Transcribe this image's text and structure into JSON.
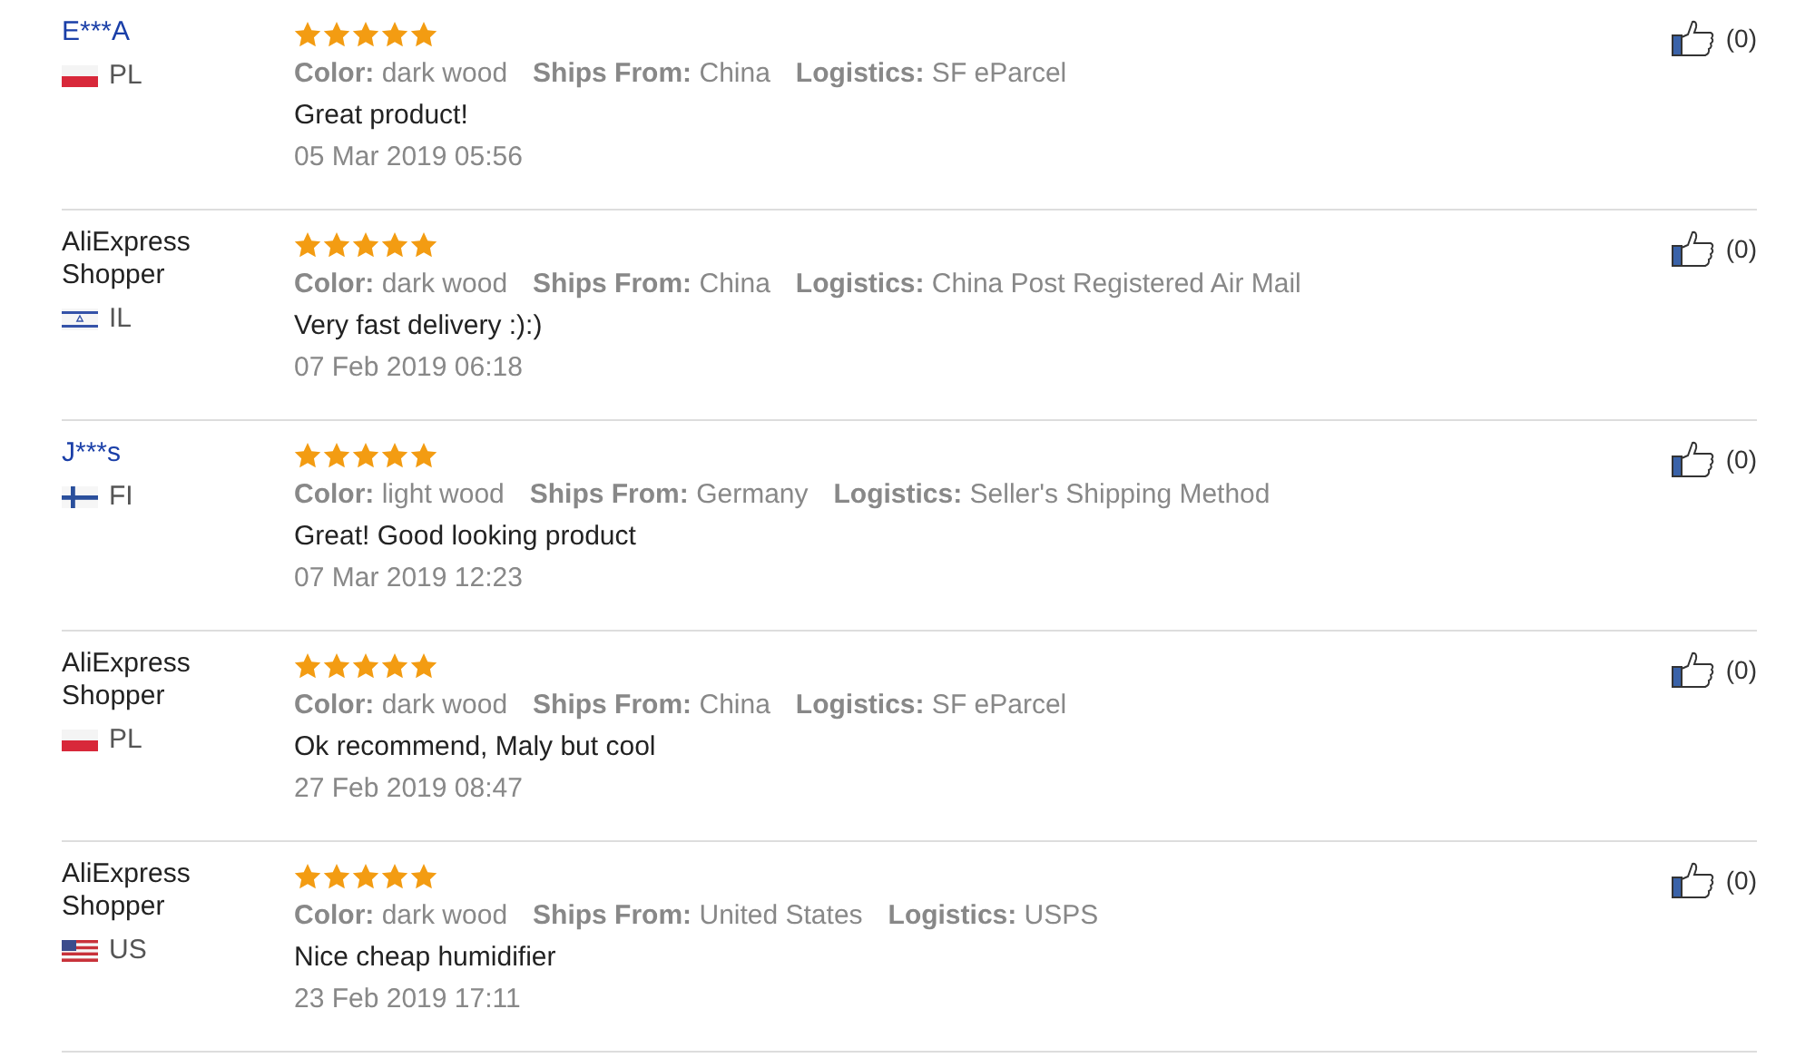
{
  "reviews": [
    {
      "name": "E***A",
      "linked": true,
      "flag": {
        "kind": "pl"
      },
      "country": "PL",
      "stars": 5,
      "attributes": [
        {
          "label": "Color:",
          "value": "dark wood"
        },
        {
          "label": "Ships From:",
          "value": "China"
        },
        {
          "label": "Logistics:",
          "value": "SF eParcel"
        }
      ],
      "text": "Great product!",
      "date": "05 Mar 2019 05:56",
      "likes": "(0)"
    },
    {
      "name": "AliExpress Shopper",
      "linked": false,
      "flag": {
        "kind": "il"
      },
      "country": "IL",
      "stars": 5,
      "attributes": [
        {
          "label": "Color:",
          "value": "dark wood"
        },
        {
          "label": "Ships From:",
          "value": "China"
        },
        {
          "label": "Logistics:",
          "value": "China Post Registered Air Mail"
        }
      ],
      "text": "Very fast delivery :):)",
      "date": "07 Feb 2019 06:18",
      "likes": "(0)"
    },
    {
      "name": "J***s",
      "linked": true,
      "flag": {
        "kind": "fi"
      },
      "country": "FI",
      "stars": 5,
      "attributes": [
        {
          "label": "Color:",
          "value": "light wood"
        },
        {
          "label": "Ships From:",
          "value": "Germany"
        },
        {
          "label": "Logistics:",
          "value": "Seller's Shipping Method"
        }
      ],
      "text": "Great! Good looking product",
      "date": "07 Mar 2019 12:23",
      "likes": "(0)"
    },
    {
      "name": "AliExpress Shopper",
      "linked": false,
      "flag": {
        "kind": "pl"
      },
      "country": "PL",
      "stars": 5,
      "attributes": [
        {
          "label": "Color:",
          "value": "dark wood"
        },
        {
          "label": "Ships From:",
          "value": "China"
        },
        {
          "label": "Logistics:",
          "value": "SF eParcel"
        }
      ],
      "text": "Ok recommend, Maly but cool",
      "date": "27 Feb 2019 08:47",
      "likes": "(0)"
    },
    {
      "name": "AliExpress Shopper",
      "linked": false,
      "flag": {
        "kind": "us"
      },
      "country": "US",
      "stars": 5,
      "attributes": [
        {
          "label": "Color:",
          "value": "dark wood"
        },
        {
          "label": "Ships From:",
          "value": "United States"
        },
        {
          "label": "Logistics:",
          "value": "USPS"
        }
      ],
      "text": "Nice cheap humidifier",
      "date": "23 Feb 2019 17:11",
      "likes": "(0)"
    }
  ]
}
